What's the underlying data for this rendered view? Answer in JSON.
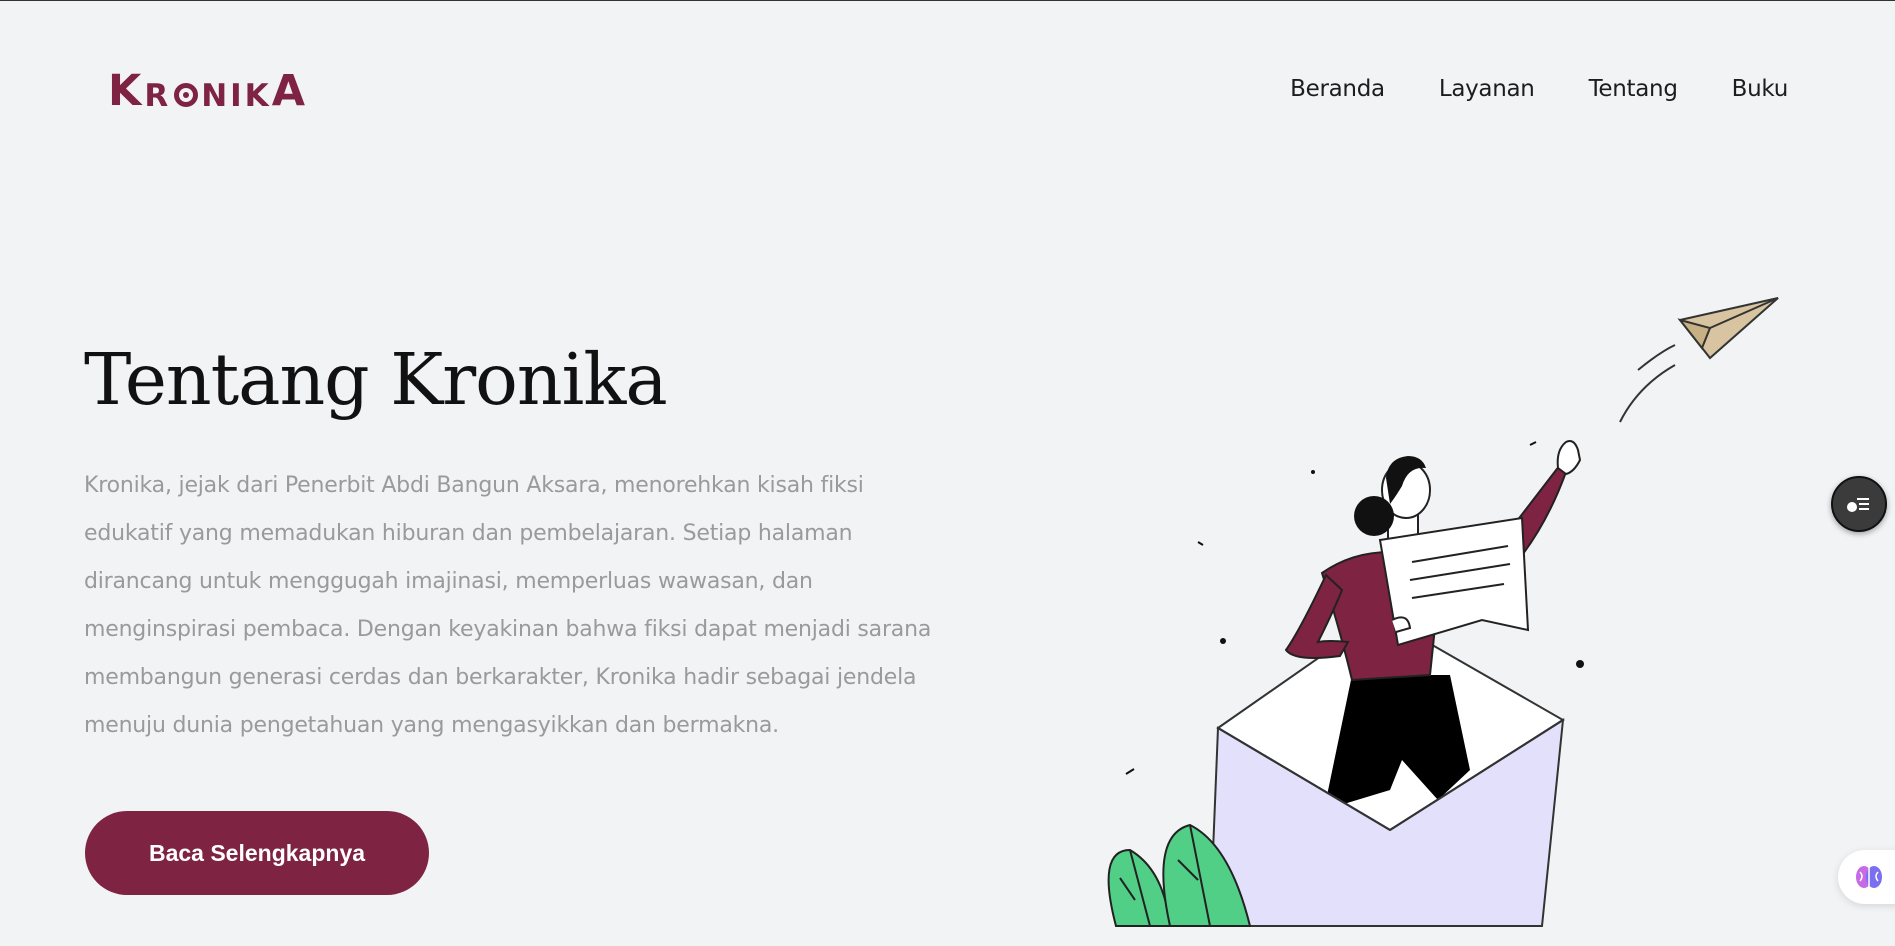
{
  "header": {
    "logo_text": "KRONIKA",
    "nav": [
      {
        "label": "Beranda"
      },
      {
        "label": "Layanan"
      },
      {
        "label": "Tentang"
      },
      {
        "label": "Buku"
      }
    ]
  },
  "hero": {
    "title": "Tentang Kronika",
    "paragraph": "Kronika, jejak dari Penerbit Abdi Bangun Aksara, menorehkan kisah fiksi edukatif yang memadukan hiburan dan pembelajaran. Setiap halaman dirancang untuk menggugah imajinasi, memperluas wawasan, dan menginspirasi pembaca. Dengan keyakinan bahwa fiksi dapat menjadi sarana membangun generasi cerdas dan berkarakter, Kronika hadir sebagai jendela menuju dunia pengetahuan yang mengasyikkan dan bermakna.",
    "cta_label": "Baca Selengkapnya"
  },
  "icons": {
    "toc": "list-icon",
    "ai": "brain-icon",
    "illustration": "woman-envelope-paper-plane"
  },
  "colors": {
    "brand": "#7e2341",
    "background": "#f2f3f5",
    "body_text": "#9a9a9a",
    "envelope": "#e2e0fb",
    "leaf": "#52cf86",
    "paper_plane": "#d8c4a0"
  }
}
